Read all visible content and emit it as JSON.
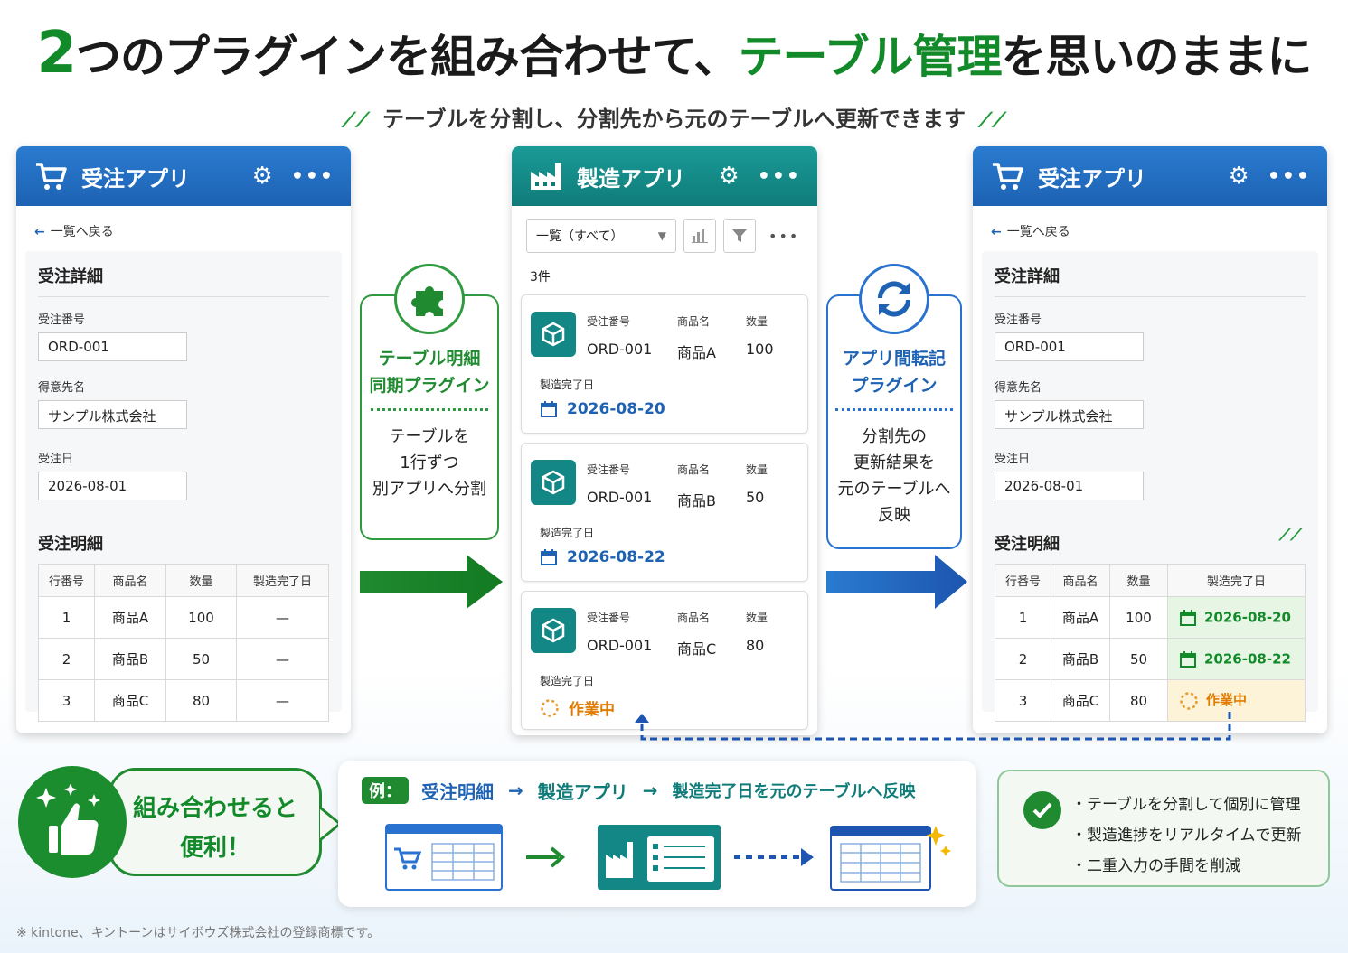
{
  "headline": {
    "part1_num": "2",
    "part1_text": "つのプラグインを組み合わせて、",
    "part2": "テーブル管理",
    "part3": "を思いのままに"
  },
  "subheadline": "テーブルを分割し、分割先から元のテーブルへ更新できます",
  "colors": {
    "green": "#138a2a",
    "blue": "#1d62b3",
    "teal": "#0f7c7a",
    "orange": "#e07b00"
  },
  "order_app_left": {
    "title": "受注アプリ",
    "back_link": "一覧へ戻る",
    "detail_title": "受注詳細",
    "fields": [
      {
        "label": "受注番号",
        "value": "ORD-001"
      },
      {
        "label": "得意先名",
        "value": "サンプル株式会社"
      },
      {
        "label": "受注日",
        "value": "2026-08-01"
      }
    ],
    "table_title": "受注明細",
    "table": {
      "headers": [
        "行番号",
        "商品名",
        "数量",
        "製造完了日"
      ],
      "rows": [
        [
          "1",
          "商品A",
          "100",
          "—"
        ],
        [
          "2",
          "商品B",
          "50",
          "—"
        ],
        [
          "3",
          "商品C",
          "80",
          "—"
        ]
      ]
    }
  },
  "plugin_sync": {
    "name_line1": "テーブル明細",
    "name_line2": "同期プラグイン",
    "desc_line1": "テーブルを",
    "desc_line2": "1行ずつ",
    "desc_line3": "別アプリへ分割"
  },
  "mfg_app": {
    "title": "製造アプリ",
    "view_select": "一覧（すべて）",
    "count": "3件",
    "labels": {
      "order_no": "受注番号",
      "product": "商品名",
      "qty": "数量",
      "done_date": "製造完了日"
    },
    "records": [
      {
        "order_no": "ORD-001",
        "product": "商品A",
        "qty": "100",
        "status": "2026-08-20"
      },
      {
        "order_no": "ORD-001",
        "product": "商品B",
        "qty": "50",
        "status": "2026-08-22"
      },
      {
        "order_no": "ORD-001",
        "product": "商品C",
        "qty": "80",
        "status": "作業中"
      }
    ]
  },
  "plugin_transfer": {
    "name_line1": "アプリ間転記",
    "name_line2": "プラグイン",
    "desc_line1": "分割先の",
    "desc_line2": "更新結果を",
    "desc_line3": "元のテーブルへ",
    "desc_line4": "反映"
  },
  "order_app_right": {
    "title": "受注アプリ",
    "back_link": "一覧へ戻る",
    "detail_title": "受注詳細",
    "fields": [
      {
        "label": "受注番号",
        "value": "ORD-001"
      },
      {
        "label": "得意先名",
        "value": "サンプル株式会社"
      },
      {
        "label": "受注日",
        "value": "2026-08-01"
      }
    ],
    "table_title": "受注明細",
    "table": {
      "headers": [
        "行番号",
        "商品名",
        "数量",
        "製造完了日"
      ],
      "rows": [
        [
          "1",
          "商品A",
          "100",
          "2026-08-20"
        ],
        [
          "2",
          "商品B",
          "50",
          "2026-08-22"
        ],
        [
          "3",
          "商品C",
          "80",
          "作業中"
        ]
      ]
    }
  },
  "bubble": {
    "line1": "組み合わせると",
    "line2": "便利！"
  },
  "example": {
    "tag": "例：",
    "step1": "受注明細",
    "step2": "製造アプリ",
    "step3": "製造完了日を元のテーブルへ反映",
    "arrow": "→"
  },
  "benefits": [
    "テーブルを分割して個別に管理",
    "製造進捗をリアルタイムで更新",
    "二重入力の手間を削減"
  ],
  "footnote": "※ kintone、キントーンはサイボウズ株式会社の登録商標です。"
}
